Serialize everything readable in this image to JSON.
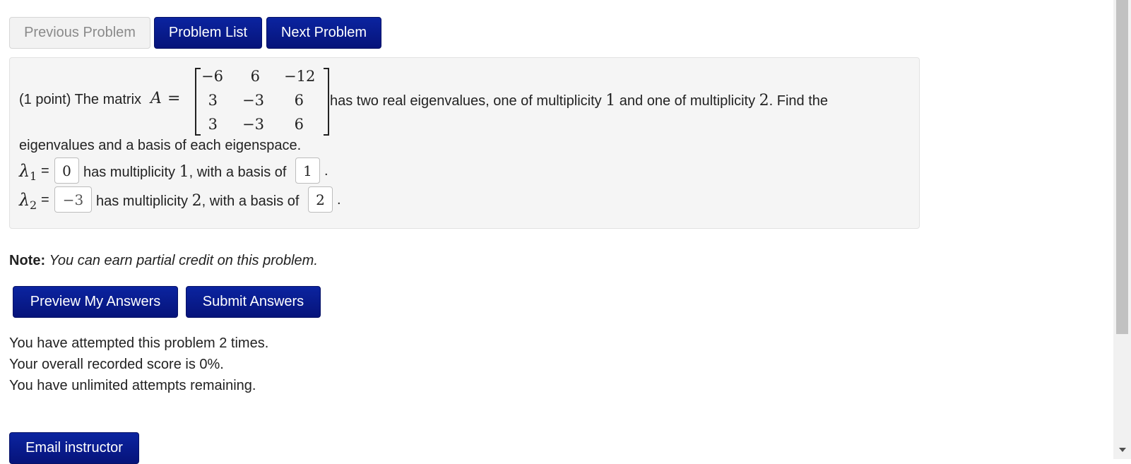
{
  "nav": {
    "previous_label": "Previous Problem",
    "list_label": "Problem List",
    "next_label": "Next Problem"
  },
  "problem": {
    "prefix": "(1 point) The matrix ",
    "matrix_var": "A",
    "equals": "=",
    "matrix": [
      [
        "−6",
        "6",
        "−12"
      ],
      [
        "3",
        "−3",
        "6"
      ],
      [
        "3",
        "−3",
        "6"
      ]
    ],
    "statement_a": "has two real eigenvalues, one of multiplicity ",
    "mult1": "1",
    "statement_b": " and one of multiplicity ",
    "mult2": "2",
    "statement_c": ". Find the",
    "statement_line2": "eigenvalues and a basis of each eigenspace.",
    "lambda1_label": "λ",
    "lambda1_sub": "1",
    "lambda2_label": "λ",
    "lambda2_sub": "2",
    "eq_sign": "=",
    "lambda1_value": "0",
    "lambda2_value": "−3",
    "has_mult": "has multiplicity ",
    "with_basis": ", with a basis of",
    "row1_mult": "1",
    "row2_mult": "2",
    "basis1_value": "1",
    "basis2_value": "2",
    "period": "."
  },
  "note": {
    "label": "Note:",
    "text": "You can earn partial credit on this problem."
  },
  "actions": {
    "preview_label": "Preview My Answers",
    "submit_label": "Submit Answers"
  },
  "status": {
    "attempts": "You have attempted this problem 2 times.",
    "score": "Your overall recorded score is 0%.",
    "remaining": "You have unlimited attempts remaining."
  },
  "footer": {
    "email_label": "Email instructor"
  },
  "colors": {
    "primary_button": "#0a1e8c",
    "problem_background": "#f5f5f5"
  }
}
